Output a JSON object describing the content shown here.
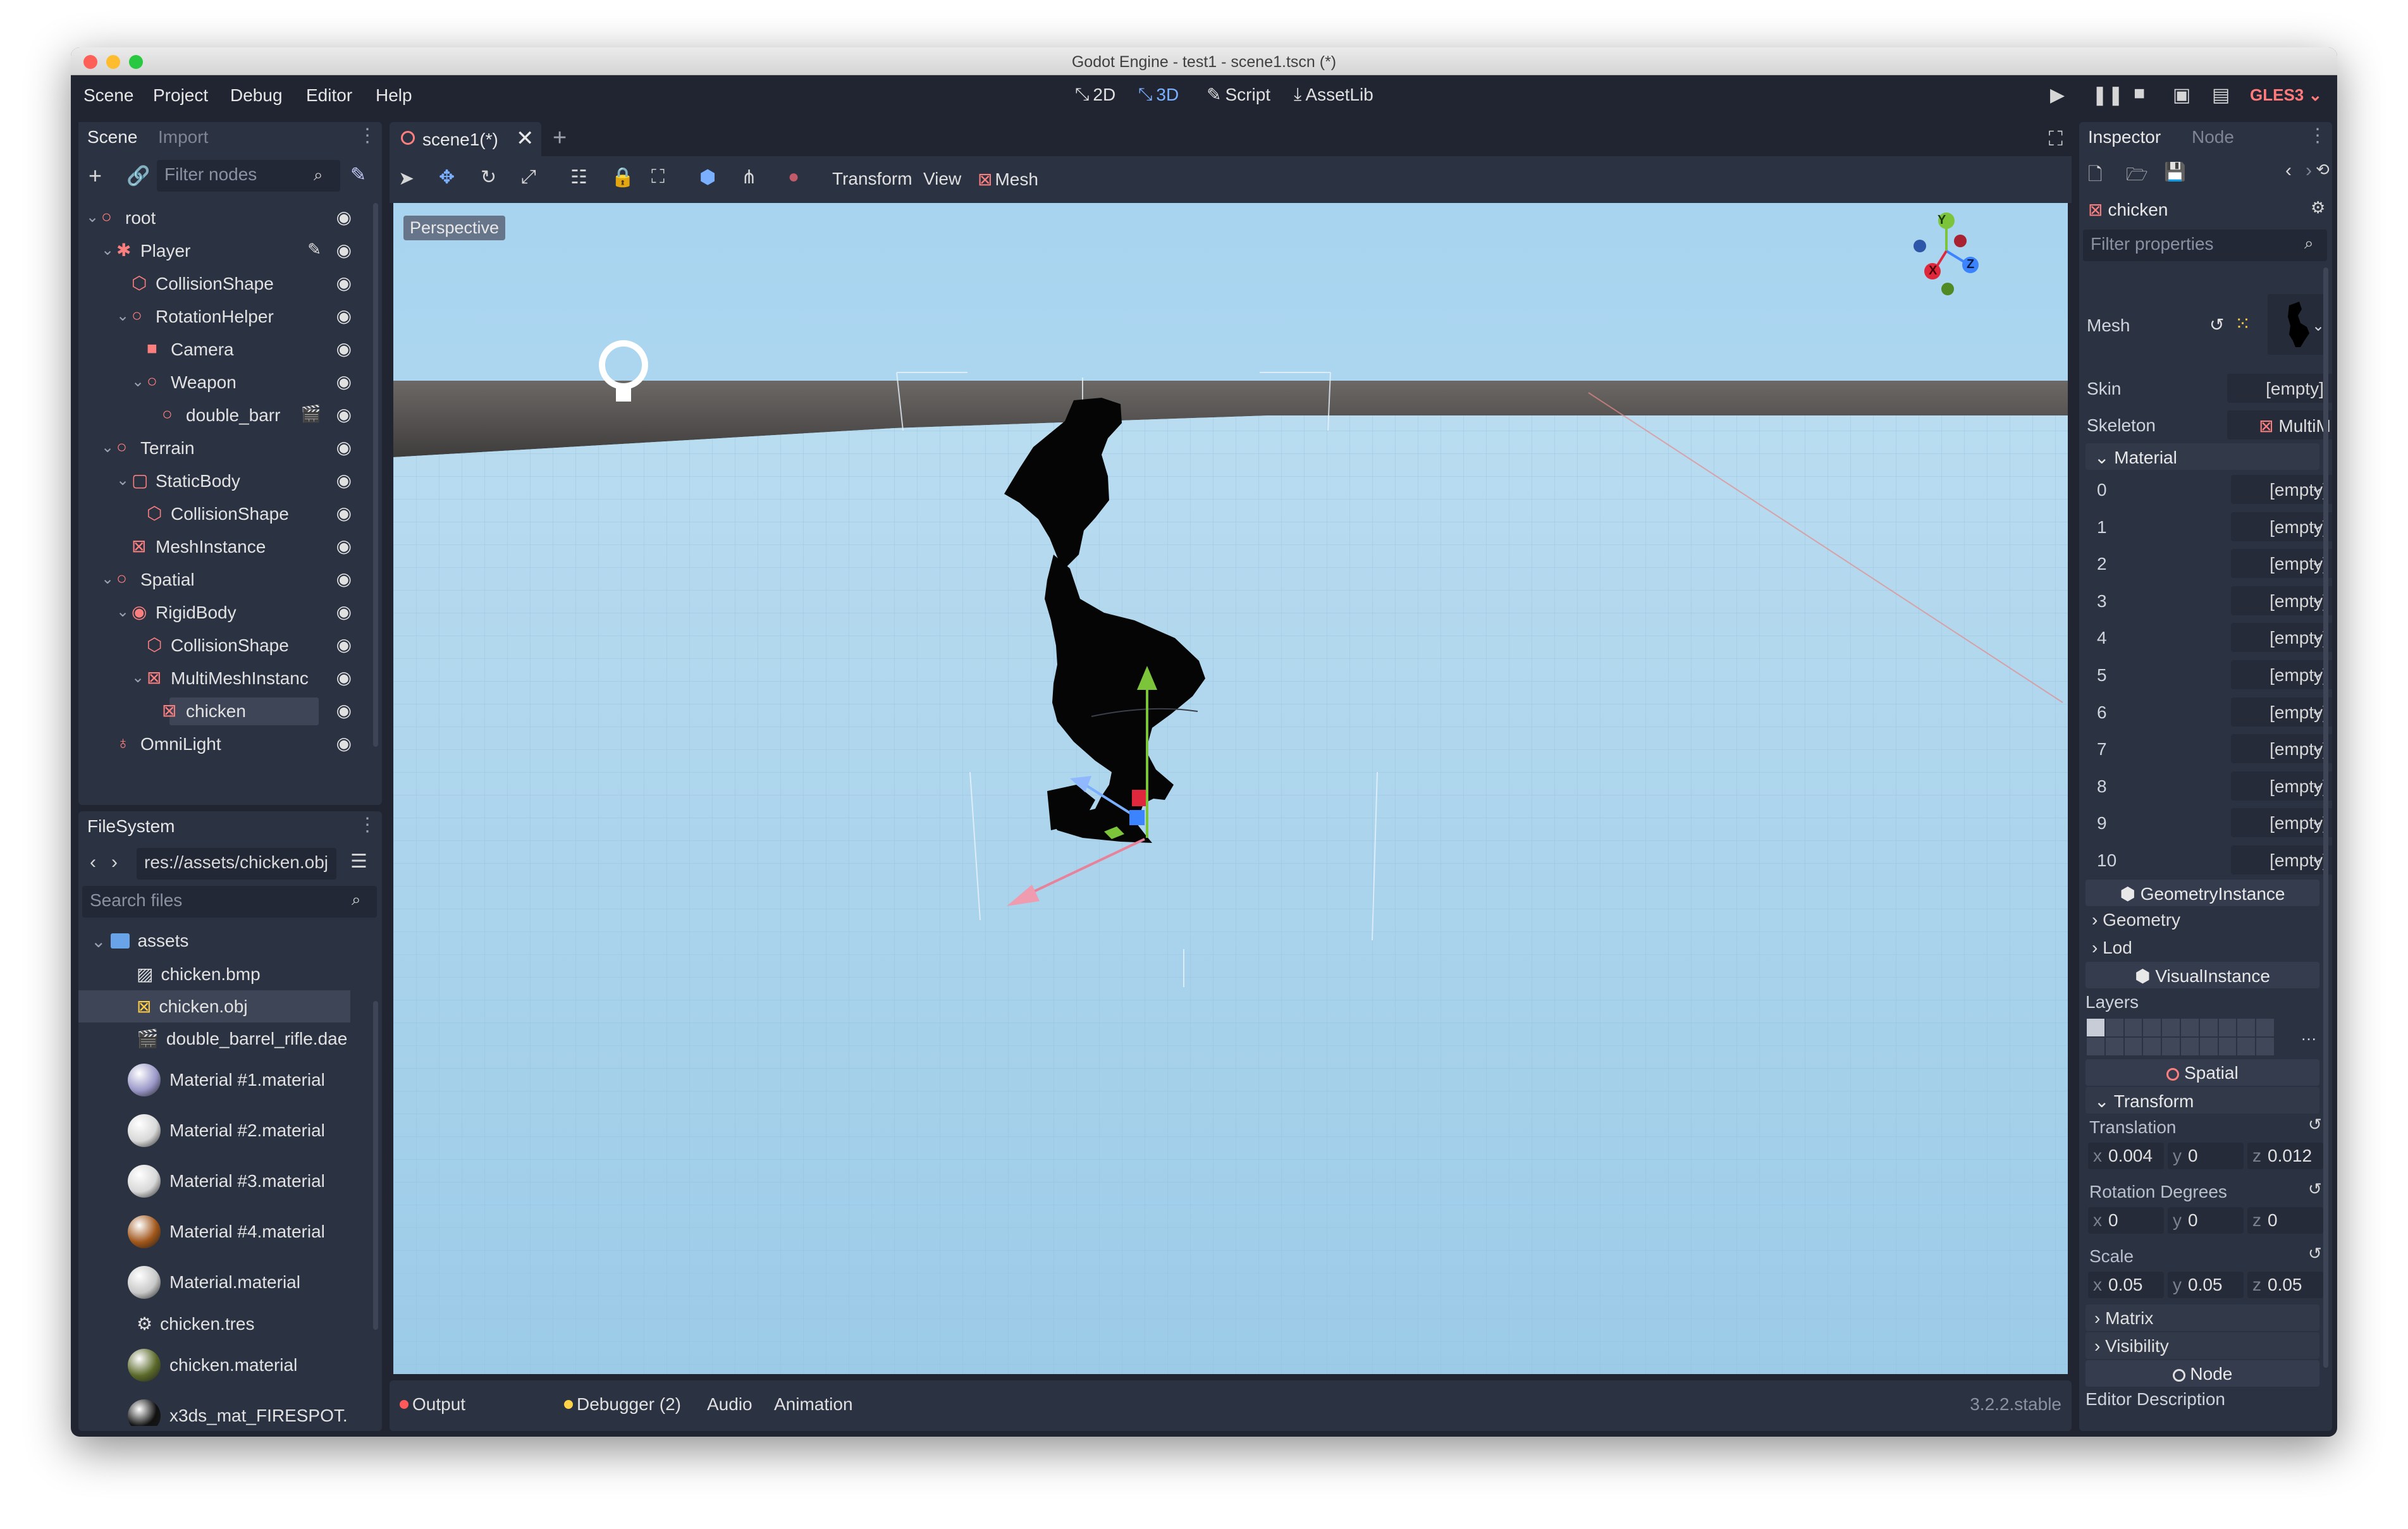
{
  "window": {
    "title": "Godot Engine - test1 - scene1.tscn (*)"
  },
  "menu": [
    "Scene",
    "Project",
    "Debug",
    "Editor",
    "Help"
  ],
  "workspaces": [
    {
      "label": "2D",
      "icon": "2d-icon"
    },
    {
      "label": "3D",
      "icon": "3d-icon",
      "active": true
    },
    {
      "label": "Script",
      "icon": "script-icon"
    },
    {
      "label": "AssetLib",
      "icon": "assetlib-icon"
    }
  ],
  "renderer": "GLES3",
  "scene_dock": {
    "tabs": [
      "Scene",
      "Import"
    ],
    "filter_placeholder": "Filter nodes",
    "tree": [
      {
        "label": "root",
        "depth": 0,
        "icon": "spatial-icon",
        "expanded": true
      },
      {
        "label": "Player",
        "depth": 1,
        "icon": "kinematic-body-icon",
        "expanded": true,
        "script": true
      },
      {
        "label": "CollisionShape",
        "depth": 2,
        "icon": "collision-shape-icon"
      },
      {
        "label": "RotationHelper",
        "depth": 2,
        "icon": "spatial-icon",
        "expanded": true
      },
      {
        "label": "Camera",
        "depth": 3,
        "icon": "camera-icon"
      },
      {
        "label": "Weapon",
        "depth": 3,
        "icon": "spatial-icon",
        "expanded": true
      },
      {
        "label": "double_barr",
        "depth": 4,
        "icon": "spatial-icon",
        "scene": true
      },
      {
        "label": "Terrain",
        "depth": 1,
        "icon": "spatial-icon",
        "expanded": true
      },
      {
        "label": "StaticBody",
        "depth": 2,
        "icon": "static-body-icon",
        "expanded": true
      },
      {
        "label": "CollisionShape",
        "depth": 3,
        "icon": "collision-shape-icon"
      },
      {
        "label": "MeshInstance",
        "depth": 2,
        "icon": "mesh-instance-icon"
      },
      {
        "label": "Spatial",
        "depth": 1,
        "icon": "spatial-icon",
        "expanded": true
      },
      {
        "label": "RigidBody",
        "depth": 2,
        "icon": "rigid-body-icon",
        "expanded": true
      },
      {
        "label": "CollisionShape",
        "depth": 3,
        "icon": "collision-shape-icon"
      },
      {
        "label": "MultiMeshInstanc",
        "depth": 3,
        "icon": "multimesh-icon",
        "expanded": true
      },
      {
        "label": "chicken",
        "depth": 4,
        "icon": "mesh-instance-icon",
        "selected": true
      },
      {
        "label": "OmniLight",
        "depth": 1,
        "icon": "omnilight-icon"
      }
    ]
  },
  "filesystem": {
    "tab": "FileSystem",
    "path": "res://assets/chicken.obj",
    "search_placeholder": "Search files",
    "folder": "assets",
    "items": [
      {
        "label": "chicken.bmp",
        "icon": "image-file-icon"
      },
      {
        "label": "chicken.obj",
        "icon": "mesh-file-icon",
        "selected": true
      },
      {
        "label": "double_barrel_rifle.dae",
        "icon": "scene-file-icon"
      },
      {
        "label": "Material #1.material",
        "icon": "material-sphere-icon",
        "color": "#9a98c8"
      },
      {
        "label": "Material #2.material",
        "icon": "material-sphere-icon",
        "color": "#d8d8d8"
      },
      {
        "label": "Material #3.material",
        "icon": "material-sphere-icon",
        "color": "#d8d8d8"
      },
      {
        "label": "Material #4.material",
        "icon": "material-sphere-icon",
        "color": "#a0561a"
      },
      {
        "label": "Material.material",
        "icon": "material-sphere-icon",
        "color": "#c8c8c8"
      },
      {
        "label": "chicken.tres",
        "icon": "resource-file-icon"
      },
      {
        "label": "chicken.material",
        "icon": "material-sphere-icon",
        "color": "#5b6a2a"
      },
      {
        "label": "x3ds_mat_FIRESPOT.",
        "icon": "material-sphere-icon",
        "color": "#111111"
      }
    ]
  },
  "viewport": {
    "tab_label": "scene1(*)",
    "toolbar_menus": [
      "Transform",
      "View",
      "Mesh"
    ],
    "perspective_label": "Perspective",
    "gizmo_axes": [
      "Y",
      "X",
      "Z"
    ]
  },
  "bottom_panel": {
    "tabs": [
      {
        "label": "Output",
        "dot": "#ff5a5a"
      },
      {
        "label": "Debugger (2)",
        "dot": "#ffd24a"
      },
      {
        "label": "Audio"
      },
      {
        "label": "Animation"
      }
    ],
    "version": "3.2.2.stable"
  },
  "inspector": {
    "tabs": [
      "Inspector",
      "Node"
    ],
    "object_name": "chicken",
    "filter_placeholder": "Filter properties",
    "mesh_label": "Mesh",
    "skin": {
      "label": "Skin",
      "value": "[empty]"
    },
    "skeleton": {
      "label": "Skeleton",
      "value": "MultiM"
    },
    "material_header": "Material",
    "materials": [
      {
        "index": "0",
        "value": "[empty]"
      },
      {
        "index": "1",
        "value": "[empty]"
      },
      {
        "index": "2",
        "value": "[empty]"
      },
      {
        "index": "3",
        "value": "[empty]"
      },
      {
        "index": "4",
        "value": "[empty]"
      },
      {
        "index": "5",
        "value": "[empty]"
      },
      {
        "index": "6",
        "value": "[empty]"
      },
      {
        "index": "7",
        "value": "[empty]"
      },
      {
        "index": "8",
        "value": "[empty]"
      },
      {
        "index": "9",
        "value": "[empty]"
      },
      {
        "index": "10",
        "value": "[empty]"
      }
    ],
    "section_geometry_instance": "GeometryInstance",
    "geometry": "Geometry",
    "lod": "Lod",
    "section_visual_instance": "VisualInstance",
    "layers_label": "Layers",
    "section_spatial": "Spatial",
    "transform_header": "Transform",
    "translation": {
      "label": "Translation",
      "x": "0.004",
      "y": "0",
      "z": "0.012"
    },
    "rotation": {
      "label": "Rotation Degrees",
      "x": "0",
      "y": "0",
      "z": "0"
    },
    "scale": {
      "label": "Scale",
      "x": "0.05",
      "y": "0.05",
      "z": "0.05"
    },
    "matrix": "Matrix",
    "visibility": "Visibility",
    "section_node": "Node",
    "editor_description": "Editor Description",
    "axis_letters": {
      "x": "x",
      "y": "y",
      "z": "z"
    }
  },
  "colors": {
    "accent": "#7ab0ff",
    "node_red": "#fc7f7f",
    "sky": "#a7d3ee",
    "floor": "#9fcde8",
    "panel": "#2b3242",
    "editor_bg": "#202531"
  }
}
